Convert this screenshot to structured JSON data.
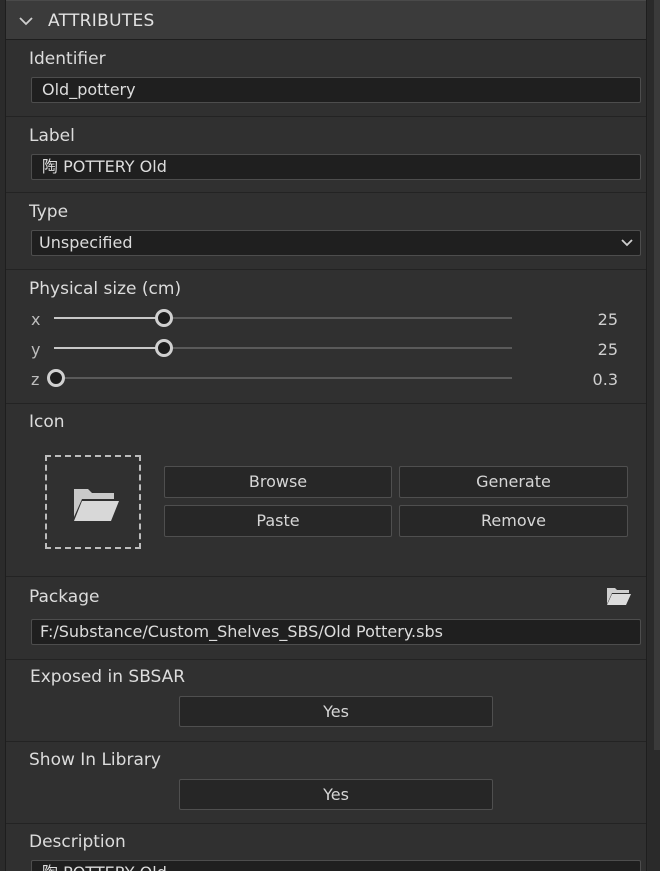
{
  "header": {
    "title": "ATTRIBUTES"
  },
  "identifier": {
    "label": "Identifier",
    "value": "Old_pottery"
  },
  "label_field": {
    "label": "Label",
    "value": "陶 POTTERY Old"
  },
  "type": {
    "label": "Type",
    "value": "Unspecified"
  },
  "physical_size": {
    "label": "Physical size (cm)",
    "sliders": [
      {
        "axis": "x",
        "value": "25",
        "fraction": 0.24
      },
      {
        "axis": "y",
        "value": "25",
        "fraction": 0.24
      },
      {
        "axis": "z",
        "value": "0.3",
        "fraction": 0.0
      }
    ]
  },
  "icon": {
    "label": "Icon",
    "buttons": {
      "browse": "Browse",
      "generate": "Generate",
      "paste": "Paste",
      "remove": "Remove"
    }
  },
  "package": {
    "label": "Package",
    "value": "F:/Substance/Custom_Shelves_SBS/Old Pottery.sbs"
  },
  "exposed": {
    "label": "Exposed in SBSAR",
    "value": "Yes"
  },
  "show_in_library": {
    "label": "Show In Library",
    "value": "Yes"
  },
  "description": {
    "label": "Description",
    "value": "陶 POTTERY Old"
  },
  "colors": {
    "panel": "#303030",
    "field": "#1f1f1f",
    "text": "#dcdcdc"
  }
}
